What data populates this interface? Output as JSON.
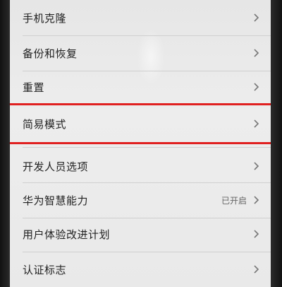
{
  "settings": {
    "items": [
      {
        "label": "手机克隆",
        "value": ""
      },
      {
        "label": "备份和恢复",
        "value": ""
      },
      {
        "label": "重置",
        "value": ""
      },
      {
        "label": "简易模式",
        "value": ""
      },
      {
        "label": "开发人员选项",
        "value": ""
      },
      {
        "label": "华为智慧能力",
        "value": "已开启"
      },
      {
        "label": "用户体验改进计划",
        "value": ""
      },
      {
        "label": "认证标志",
        "value": ""
      }
    ]
  },
  "highlight": {
    "target": "简易模式",
    "color": "#e02020"
  },
  "icons": {
    "chevron": "chevron-right-icon"
  }
}
